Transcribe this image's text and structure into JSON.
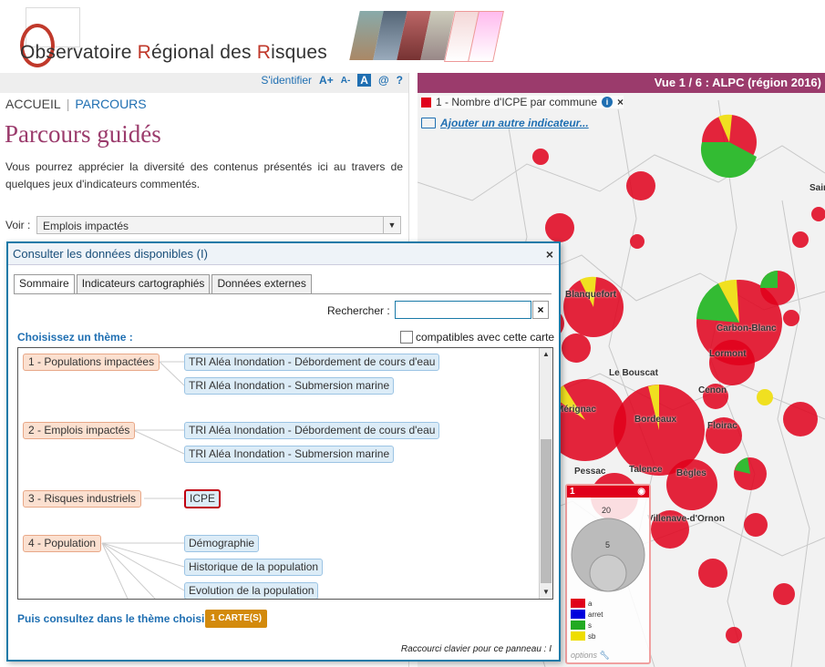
{
  "header": {
    "logo_letter": "O",
    "logo_part1": "bservatoire ",
    "logo_r1": "R",
    "logo_part2": "égional des ",
    "logo_r2": "R",
    "logo_part3": "isques"
  },
  "toolbar": {
    "login": "S'identifier",
    "font_up": "A+",
    "font_down": "A-",
    "contrast": "A",
    "contact": "@",
    "help": "?"
  },
  "breadcrumb": {
    "home": "ACCUEIL",
    "current": "PARCOURS"
  },
  "page": {
    "title": "Parcours guidés",
    "description": "Vous pourrez apprécier la diversité des contenus présentés ici au travers de quelques jeux d'indicateurs commentés.",
    "voir_label": "Voir :",
    "voir_value": "Emplois impactés"
  },
  "map": {
    "view_title": "Vue 1 / 6 : ALPC (région 2016)",
    "indicator_label": "1 - Nombre d'ICPE par commune",
    "add_indicator": "Ajouter un autre indicateur...",
    "cities": [
      "Saint",
      "Blanquefort",
      "Carbon-Blanc",
      "Lormont",
      "Le Bouscat",
      "Cenon",
      "Mérignac",
      "Bordeaux",
      "Floirac",
      "Pessac",
      "Talence",
      "Bègles",
      "Villenave-d'Ornon"
    ],
    "colors": {
      "red": "#e0001b",
      "green": "#33bb33",
      "yellow": "#f0e020"
    }
  },
  "legend": {
    "head": "1",
    "max_value": "20",
    "mid_value": "5",
    "items": [
      {
        "label": "a",
        "color": "#e0001b"
      },
      {
        "label": "arret",
        "color": "#0000dd"
      },
      {
        "label": "s",
        "color": "#22aa22"
      },
      {
        "label": "sb",
        "color": "#eedd00"
      }
    ],
    "options": "options"
  },
  "dialog": {
    "title": "Consulter les données disponibles (I)",
    "close": "×",
    "tabs": [
      "Sommaire",
      "Indicateurs cartographiés",
      "Données externes"
    ],
    "search_label": "Rechercher :",
    "search_value": "",
    "search_clear": "×",
    "choose_theme": "Choisissez un thème :",
    "compatible_label": "compatibles avec cette carte",
    "themes": [
      {
        "label": "1 - Populations impactées",
        "indicators": [
          "TRI Aléa Inondation - Débordement de cours d'eau",
          "TRI Aléa Inondation - Submersion marine"
        ]
      },
      {
        "label": "2 - Emplois impactés",
        "indicators": [
          "TRI  Aléa Inondation - Débordement de cours d'eau",
          "TRI Aléa Inondation - Submersion marine"
        ]
      },
      {
        "label": "3 - Risques industriels",
        "indicators": [
          "ICPE"
        ]
      },
      {
        "label": "4 - Population",
        "indicators": [
          "Démographie",
          "Historique de la population",
          "Evolution de la population"
        ]
      }
    ],
    "consult_label": "Puis consultez dans le thème choisi :",
    "carte_button": "1 CARTE(S)",
    "shortcut": "Raccourci clavier pour ce panneau : I"
  }
}
